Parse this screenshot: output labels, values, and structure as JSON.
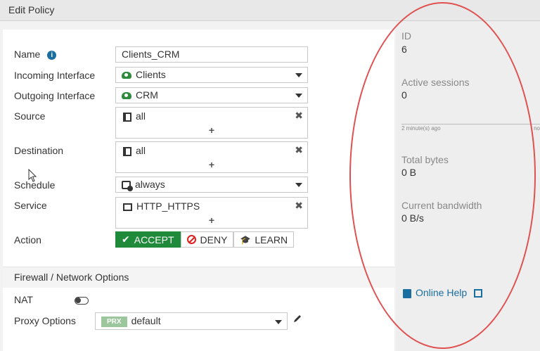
{
  "title": "Edit Policy",
  "form": {
    "name_label": "Name",
    "name_value": "Clients_CRM",
    "incoming_label": "Incoming Interface",
    "incoming_value": "Clients",
    "outgoing_label": "Outgoing Interface",
    "outgoing_value": "CRM",
    "source_label": "Source",
    "source_value": "all",
    "destination_label": "Destination",
    "destination_value": "all",
    "schedule_label": "Schedule",
    "schedule_value": "always",
    "service_label": "Service",
    "service_value": "HTTP_HTTPS",
    "action_label": "Action",
    "actions": [
      "ACCEPT",
      "DENY",
      "LEARN"
    ],
    "selected_action": "ACCEPT",
    "plus": "+",
    "remove": "✖"
  },
  "section": {
    "title": "Firewall / Network Options",
    "nat_label": "NAT",
    "nat_enabled": false,
    "proxy_label": "Proxy Options",
    "proxy_badge": "PRX",
    "proxy_value": "default"
  },
  "stats": {
    "id_label": "ID",
    "id_value": "6",
    "sessions_label": "Active sessions",
    "sessions_value": "0",
    "spark_left": "2 minute(s) ago",
    "spark_right": "no",
    "bytes_label": "Total bytes",
    "bytes_value": "0 B",
    "bandwidth_label": "Current bandwidth",
    "bandwidth_value": "0 B/s",
    "help_label": "Online Help"
  },
  "colors": {
    "accept_green": "#1e8a3a",
    "deny_red": "#e02020",
    "link_blue": "#1a6ea0",
    "annotation_red": "#e05050"
  }
}
